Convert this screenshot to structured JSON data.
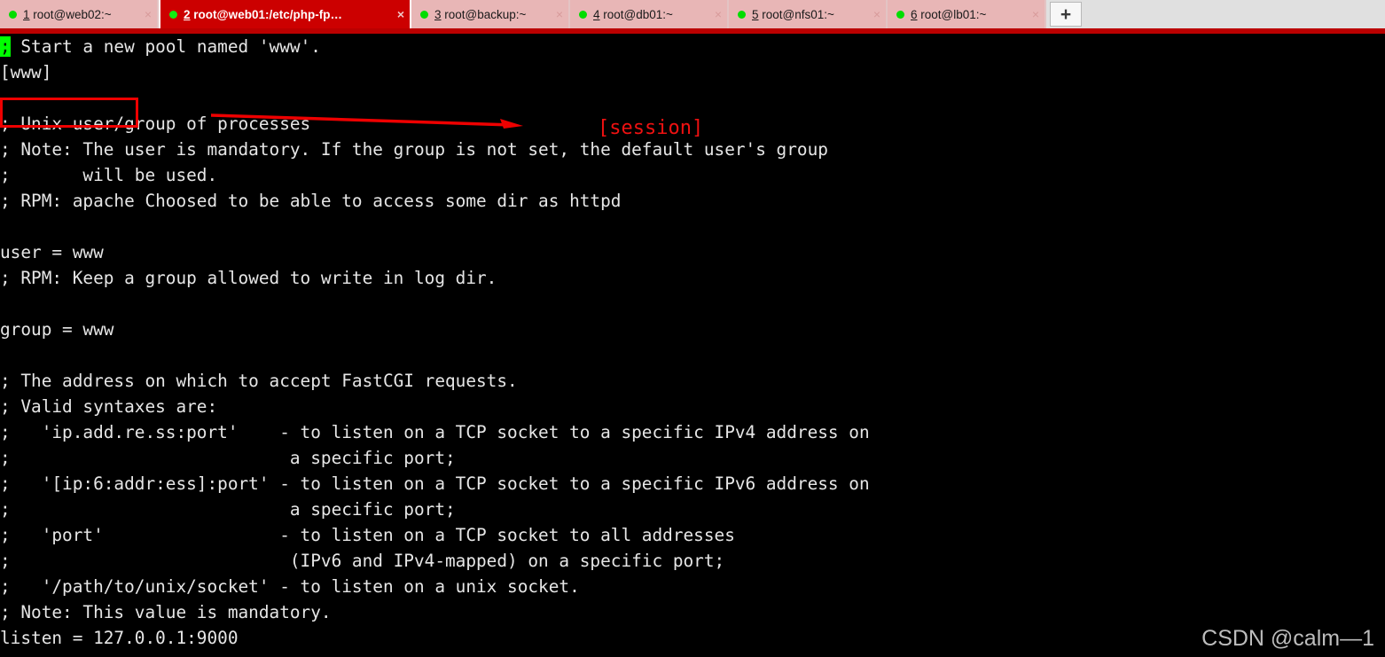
{
  "window": {
    "tab_bar": {
      "new_tab_label": "+",
      "close_glyph": "×",
      "tabs": [
        {
          "index": "1",
          "title": "root@web02:~",
          "active": false,
          "status_dot": "green-dot-icon"
        },
        {
          "index": "2",
          "title": "root@web01:/etc/php-fp…",
          "active": true,
          "status_dot": "green-dot-icon"
        },
        {
          "index": "3",
          "title": "root@backup:~",
          "active": false,
          "status_dot": "green-dot-icon"
        },
        {
          "index": "4",
          "title": "root@db01:~",
          "active": false,
          "status_dot": "green-dot-icon"
        },
        {
          "index": "5",
          "title": "root@nfs01:~",
          "active": false,
          "status_dot": "green-dot-icon"
        },
        {
          "index": "6",
          "title": "root@lb01:~",
          "active": false,
          "status_dot": "green-dot-icon"
        }
      ]
    },
    "colors": {
      "active_tab_bg": "#cc0000",
      "inactive_tab_bg": "#e8b6b6",
      "tab_bar_bg": "#e0e0e0",
      "accent_bar": "#bb0000",
      "terminal_bg": "#000000",
      "terminal_fg": "#e6e6e6",
      "cursor_bg": "#00ff00",
      "annotation_red": "#ee0000",
      "watermark_fg": "#bdbdbd"
    }
  },
  "terminal": {
    "cursor_char": ";",
    "content_after_cursor": " Start a new pool named 'www'.\n[www]\n\n; Unix user/group of processes\n; Note: The user is mandatory. If the group is not set, the default user's group\n;       will be used.\n; RPM: apache Choosed to be able to access some dir as httpd\n\nuser = www\n; RPM: Keep a group allowed to write in log dir.\n\ngroup = www\n\n; The address on which to accept FastCGI requests.\n; Valid syntaxes are:\n;   'ip.add.re.ss:port'    - to listen on a TCP socket to a specific IPv4 address on\n;                           a specific port;\n;   '[ip:6:addr:ess]:port' - to listen on a TCP socket to a specific IPv6 address on\n;                           a specific port;\n;   'port'                 - to listen on a TCP socket to all addresses\n;                           (IPv6 and IPv4-mapped) on a specific port;\n;   '/path/to/unix/socket' - to listen on a unix socket.\n; Note: This value is mandatory.\nlisten = 127.0.0.1:9000"
  },
  "annotations": {
    "highlight_box_target": "[www]",
    "session_label": "[session]",
    "arrow_direction": "right"
  },
  "watermark": {
    "text": "CSDN @calm—1"
  }
}
